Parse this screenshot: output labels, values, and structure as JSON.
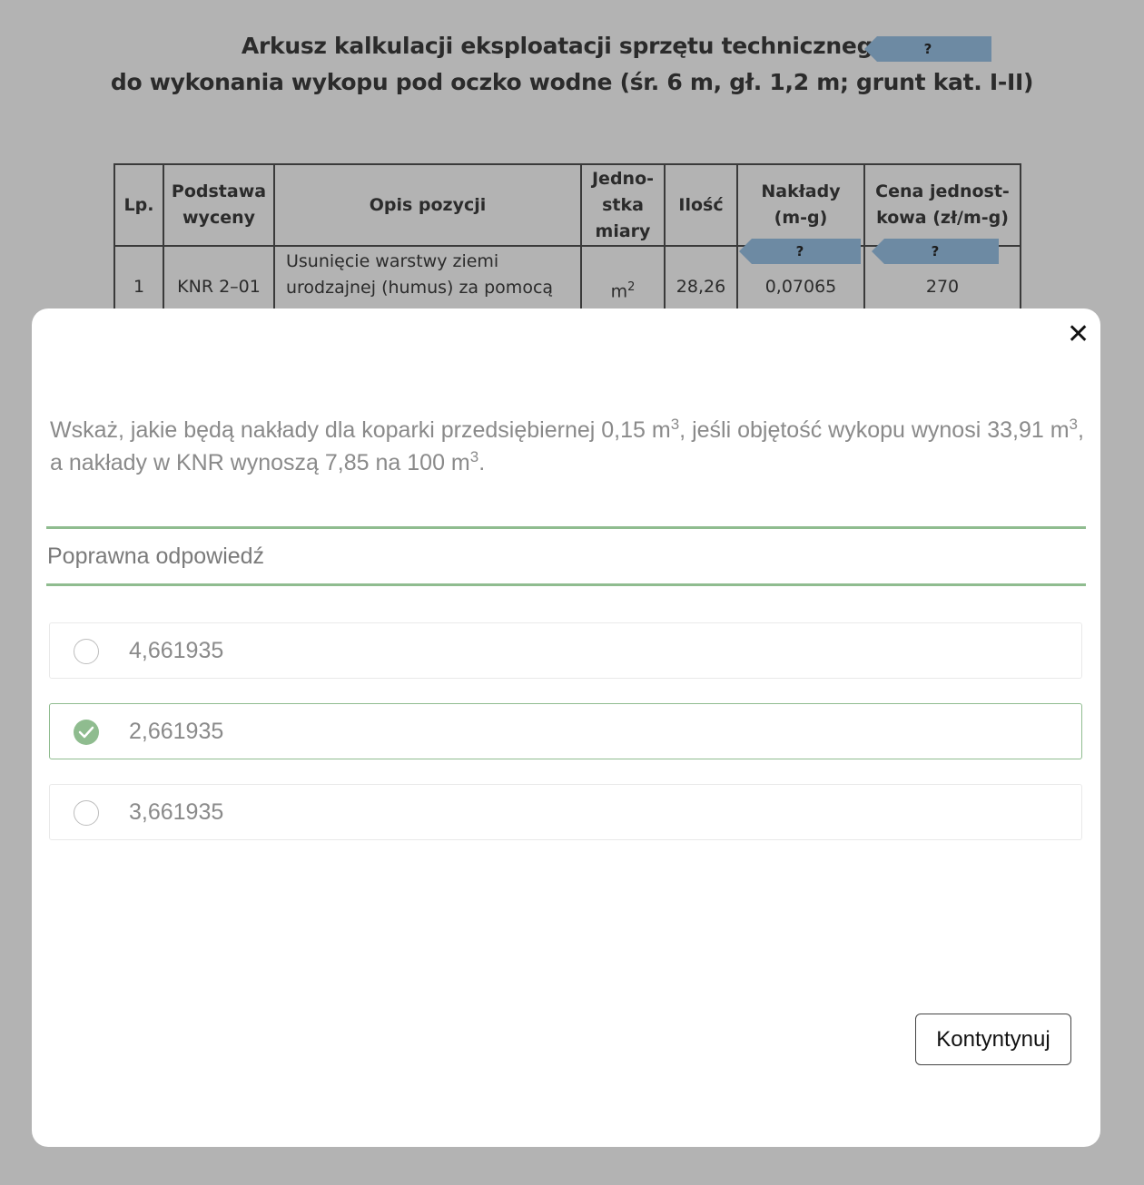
{
  "sheet": {
    "title_line1": "Arkusz kalkulacji eksploatacji sprzętu technicznego",
    "title_line2": "do wykonania wykopu pod oczko wodne (śr. 6 m, gł. 1,2 m; grunt kat. I-II)",
    "tag_text": "?",
    "columns": [
      "Lp.",
      "Podstawa wyceny",
      "Opis pozycji",
      "Jedno-stka miary",
      "Ilość",
      "Nakłady (m-g)",
      "Cena jednost-kowa (zł/m-g)"
    ],
    "row1": {
      "lp": "1",
      "basis": "KNR 2–01",
      "desc_line1": "Usunięcie warstwy ziemi",
      "desc_line2": "urodzajnej (humus) za pomocą",
      "unit": "m",
      "unit_sup": "2",
      "qty": "28,26",
      "effort": "0,07065",
      "price": "270"
    }
  },
  "modal": {
    "close_symbol": "✕",
    "question_parts": {
      "p1": "Wskaż, jakie będą nakłady dla koparki przedsiębiernej 0,15 m",
      "s1": "3",
      "p2": ", jeśli objętość wykopu wynosi 33,91 m",
      "s2": "3",
      "p3": ", a nakłady w KNR wynoszą 7,85 na 100 m",
      "s3": "3",
      "p4": "."
    },
    "answer_header": "Poprawna odpowiedź",
    "options": [
      {
        "label": "4,661935",
        "selected": false
      },
      {
        "label": "2,661935",
        "selected": true
      },
      {
        "label": "3,661935",
        "selected": false
      }
    ],
    "continue_label": "Kontyntynuj",
    "colors": {
      "correct": "#8fbc8f",
      "overlay": "#b3b3b3"
    }
  }
}
